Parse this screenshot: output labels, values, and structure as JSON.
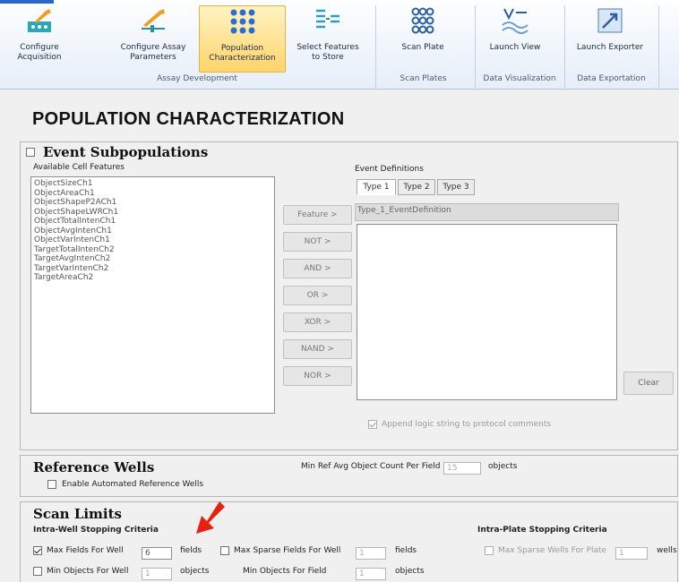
{
  "ribbon": {
    "buttons": [
      {
        "label": "Configure\nAcquisition",
        "icon": "wrench-plate-icon"
      },
      {
        "label": "Configure Assay\nParameters",
        "icon": "wrench-slider-icon"
      },
      {
        "label": "Population\nCharacterization",
        "icon": "population-grid-icon"
      },
      {
        "label": "Select Features\nto Store",
        "icon": "feature-list-icon"
      },
      {
        "label": "Scan Plate",
        "icon": "scan-plate-icon"
      },
      {
        "label": "Launch View",
        "icon": "launch-view-icon"
      },
      {
        "label": "Launch Exporter",
        "icon": "launch-exporter-icon"
      }
    ],
    "groups": [
      "Assay Development",
      "Scan Plates",
      "Data Visualization",
      "Data Exportation"
    ]
  },
  "page_title": "POPULATION CHARACTERIZATION",
  "event_subpopulations": {
    "title": "Event Subpopulations",
    "checked": false,
    "available_label": "Available Cell Features",
    "features": [
      "ObjectSizeCh1",
      "ObjectAreaCh1",
      "ObjectShapeP2ACh1",
      "ObjectShapeLWRCh1",
      "ObjectTotalIntenCh1",
      "ObjectAvgIntenCh1",
      "ObjectVarIntenCh1",
      "TargetTotalIntenCh2",
      "TargetAvgIntenCh2",
      "TargetVarIntenCh2",
      "TargetAreaCh2"
    ],
    "operators": [
      "Feature >",
      "NOT >",
      "AND >",
      "OR >",
      "XOR >",
      "NAND >",
      "NOR >"
    ],
    "event_definitions_label": "Event Definitions",
    "tabs": [
      "Type 1",
      "Type 2",
      "Type 3"
    ],
    "selected_tab": "Type 1",
    "definition_name": "Type_1_EventDefinition",
    "clear_label": "Clear",
    "append_label": "Append logic string to protocol comments",
    "append_checked": true
  },
  "reference_wells": {
    "title": "Reference Wells",
    "enable_label": "Enable Automated Reference Wells",
    "enable_checked": false,
    "min_ref_label": "Min Ref Avg Object Count Per Field",
    "min_ref_value": "15",
    "min_ref_unit": "objects"
  },
  "scan_limits": {
    "title": "Scan Limits",
    "intra_well_title": "Intra-Well Stopping Criteria",
    "intra_plate_title": "Intra-Plate Stopping Criteria",
    "max_fields_label": "Max Fields For Well",
    "max_fields_checked": true,
    "max_fields_value": "6",
    "max_fields_unit": "fields",
    "max_sparse_label": "Max Sparse Fields For Well",
    "max_sparse_checked": false,
    "max_sparse_value": "1",
    "max_sparse_unit": "fields",
    "max_sparse_wells_label": "Max Sparse Wells For Plate",
    "max_sparse_wells_checked": false,
    "max_sparse_wells_value": "1",
    "max_sparse_wells_unit": "wells",
    "min_objects_label": "Min Objects For Well",
    "min_objects_checked": false,
    "min_objects_value": "1",
    "min_objects_unit": "objects",
    "min_objects_field_label": "Min Objects For Field",
    "min_objects_field_value": "1",
    "min_objects_field_unit": "objects"
  },
  "colors": {
    "ribbon_active": "#ffd46a",
    "arrow": "#e8200e"
  }
}
